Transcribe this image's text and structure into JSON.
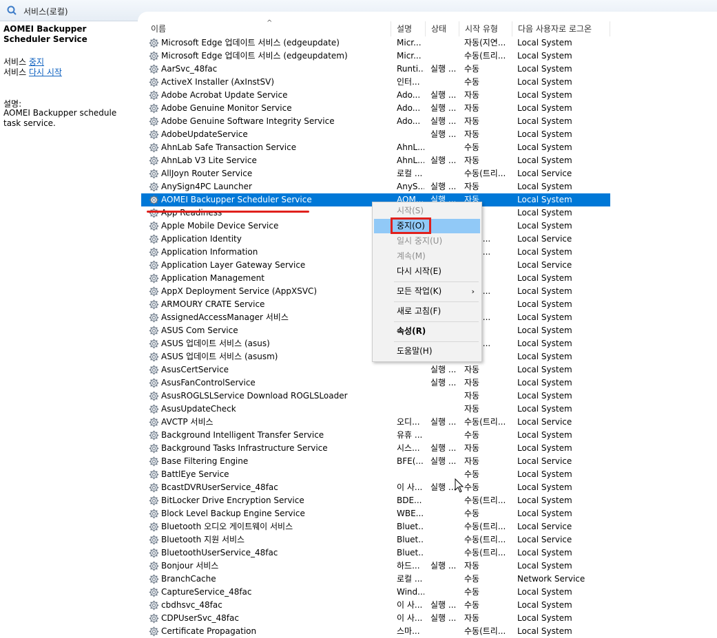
{
  "window": {
    "title": "서비스(로컬)"
  },
  "left_pane": {
    "service_title": "AOMEI Backupper Scheduler Service",
    "stop_prefix": "서비스 ",
    "stop_link": "중지",
    "restart_prefix": "서비스 ",
    "restart_link": "다시 시작",
    "desc_label": "설명:",
    "desc_text": "AOMEI Backupper schedule task service."
  },
  "columns": {
    "name": "이름",
    "desc": "설명",
    "status": "상태",
    "start": "시작 유형",
    "logon": "다음 사용자로 로그온"
  },
  "services": [
    {
      "name": "Microsoft Edge 업데이트 서비스 (edgeupdate)",
      "desc": "Micr...",
      "status": "",
      "start": "자동(지연...",
      "logon": "Local System"
    },
    {
      "name": "Microsoft Edge 업데이트 서비스 (edgeupdatem)",
      "desc": "Micr...",
      "status": "",
      "start": "수동(트리...",
      "logon": "Local System"
    },
    {
      "name": "AarSvc_48fac",
      "desc": "Runti...",
      "status": "실행 ...",
      "start": "수동",
      "logon": "Local System"
    },
    {
      "name": "ActiveX Installer (AxInstSV)",
      "desc": "인터...",
      "status": "",
      "start": "수동",
      "logon": "Local System"
    },
    {
      "name": "Adobe Acrobat Update Service",
      "desc": "Ado...",
      "status": "실행 ...",
      "start": "자동",
      "logon": "Local System"
    },
    {
      "name": "Adobe Genuine Monitor Service",
      "desc": "Ado...",
      "status": "실행 ...",
      "start": "자동",
      "logon": "Local System"
    },
    {
      "name": "Adobe Genuine Software Integrity Service",
      "desc": "Ado...",
      "status": "실행 ...",
      "start": "자동",
      "logon": "Local System"
    },
    {
      "name": "AdobeUpdateService",
      "desc": "",
      "status": "실행 ...",
      "start": "자동",
      "logon": "Local System"
    },
    {
      "name": "AhnLab Safe Transaction Service",
      "desc": "AhnL...",
      "status": "",
      "start": "수동",
      "logon": "Local System"
    },
    {
      "name": "AhnLab V3 Lite Service",
      "desc": "AhnL...",
      "status": "실행 ...",
      "start": "자동",
      "logon": "Local System"
    },
    {
      "name": "AllJoyn Router Service",
      "desc": "로컬 ...",
      "status": "",
      "start": "수동(트리...",
      "logon": "Local Service"
    },
    {
      "name": "AnySign4PC Launcher",
      "desc": "AnyS...",
      "status": "실행 ...",
      "start": "자동",
      "logon": "Local System"
    },
    {
      "name": "AOMEI Backupper Scheduler Service",
      "desc": "AOM...",
      "status": "실행 ...",
      "start": "자동",
      "logon": "Local System",
      "selected": true
    },
    {
      "name": "App Readiness",
      "desc": "",
      "status": "",
      "start": "",
      "logon": "Local System"
    },
    {
      "name": "Apple Mobile Device Service",
      "desc": "",
      "status": "",
      "start": "",
      "logon": "Local System"
    },
    {
      "name": "Application Identity",
      "desc": "",
      "status": "",
      "start": "(트리...",
      "logon": "Local Service"
    },
    {
      "name": "Application Information",
      "desc": "",
      "status": "",
      "start": "(트리...",
      "logon": "Local System"
    },
    {
      "name": "Application Layer Gateway Service",
      "desc": "",
      "status": "",
      "start": "",
      "logon": "Local Service"
    },
    {
      "name": "Application Management",
      "desc": "",
      "status": "",
      "start": "",
      "logon": "Local System"
    },
    {
      "name": "AppX Deployment Service (AppXSVC)",
      "desc": "",
      "status": "",
      "start": "(트리...",
      "logon": "Local System"
    },
    {
      "name": "ARMOURY CRATE Service",
      "desc": "",
      "status": "",
      "start": "",
      "logon": "Local System"
    },
    {
      "name": "AssignedAccessManager 서비스",
      "desc": "",
      "status": "",
      "start": "(트리...",
      "logon": "Local System"
    },
    {
      "name": "ASUS Com Service",
      "desc": "",
      "status": "",
      "start": "",
      "logon": "Local System"
    },
    {
      "name": "ASUS 업데이트 서비스 (asus)",
      "desc": "",
      "status": "",
      "start": "(지연...",
      "logon": "Local System"
    },
    {
      "name": "ASUS 업데이트 서비스 (asusm)",
      "desc": "",
      "status": "",
      "start": "",
      "logon": "Local System"
    },
    {
      "name": "AsusCertService",
      "desc": "",
      "status": "실행 ...",
      "start": "자동",
      "logon": "Local System"
    },
    {
      "name": "AsusFanControlService",
      "desc": "",
      "status": "실행 ...",
      "start": "자동",
      "logon": "Local System"
    },
    {
      "name": "AsusROGLSLService Download ROGLSLoader",
      "desc": "",
      "status": "",
      "start": "자동",
      "logon": "Local System"
    },
    {
      "name": "AsusUpdateCheck",
      "desc": "",
      "status": "",
      "start": "자동",
      "logon": "Local System"
    },
    {
      "name": "AVCTP 서비스",
      "desc": "오디...",
      "status": "실행 ...",
      "start": "수동(트리...",
      "logon": "Local Service"
    },
    {
      "name": "Background Intelligent Transfer Service",
      "desc": "유휴 ...",
      "status": "",
      "start": "수동",
      "logon": "Local System"
    },
    {
      "name": "Background Tasks Infrastructure Service",
      "desc": "시스...",
      "status": "실행 ...",
      "start": "자동",
      "logon": "Local System"
    },
    {
      "name": "Base Filtering Engine",
      "desc": "BFE(...",
      "status": "실행 ...",
      "start": "자동",
      "logon": "Local Service"
    },
    {
      "name": "BattlEye Service",
      "desc": "",
      "status": "",
      "start": "수동",
      "logon": "Local System"
    },
    {
      "name": "BcastDVRUserService_48fac",
      "desc": "이 사...",
      "status": "실행 ...",
      "start": "수동",
      "logon": "Local System"
    },
    {
      "name": "BitLocker Drive Encryption Service",
      "desc": "BDE...",
      "status": "",
      "start": "수동(트리...",
      "logon": "Local System"
    },
    {
      "name": "Block Level Backup Engine Service",
      "desc": "WBE...",
      "status": "",
      "start": "수동",
      "logon": "Local System"
    },
    {
      "name": "Bluetooth 오디오 게이트웨이 서비스",
      "desc": "Bluet...",
      "status": "",
      "start": "수동(트리...",
      "logon": "Local Service"
    },
    {
      "name": "Bluetooth 지원 서비스",
      "desc": "Bluet...",
      "status": "",
      "start": "수동(트리...",
      "logon": "Local Service"
    },
    {
      "name": "BluetoothUserService_48fac",
      "desc": "Bluet...",
      "status": "",
      "start": "수동(트리...",
      "logon": "Local System"
    },
    {
      "name": "Bonjour 서비스",
      "desc": "하드...",
      "status": "실행 ...",
      "start": "자동",
      "logon": "Local System"
    },
    {
      "name": "BranchCache",
      "desc": "로컬 ...",
      "status": "",
      "start": "수동",
      "logon": "Network Service"
    },
    {
      "name": "CaptureService_48fac",
      "desc": "Wind...",
      "status": "",
      "start": "수동",
      "logon": "Local System"
    },
    {
      "name": "cbdhsvc_48fac",
      "desc": "이 사...",
      "status": "실행 ...",
      "start": "수동",
      "logon": "Local System"
    },
    {
      "name": "CDPUserSvc_48fac",
      "desc": "이 사...",
      "status": "실행 ...",
      "start": "자동",
      "logon": "Local System"
    },
    {
      "name": "Certificate Propagation",
      "desc": "스마...",
      "status": "",
      "start": "수동(트리...",
      "logon": "Local System"
    }
  ],
  "context_menu": {
    "start": "시작(S)",
    "stop": "중지(O)",
    "pause": "일시 중지(U)",
    "resume": "계속(M)",
    "restart": "다시 시작(E)",
    "all_tasks": "모든 작업(K)",
    "refresh": "새로 고침(F)",
    "properties": "속성(R)",
    "help": "도움말(H)"
  },
  "colors": {
    "selection": "#0078d7",
    "menu_highlight": "#91c9f7",
    "annotation_red": "#e0201c",
    "link": "#0b5fbf"
  },
  "icons": {
    "service": "gear-icon",
    "title": "services-icon"
  }
}
